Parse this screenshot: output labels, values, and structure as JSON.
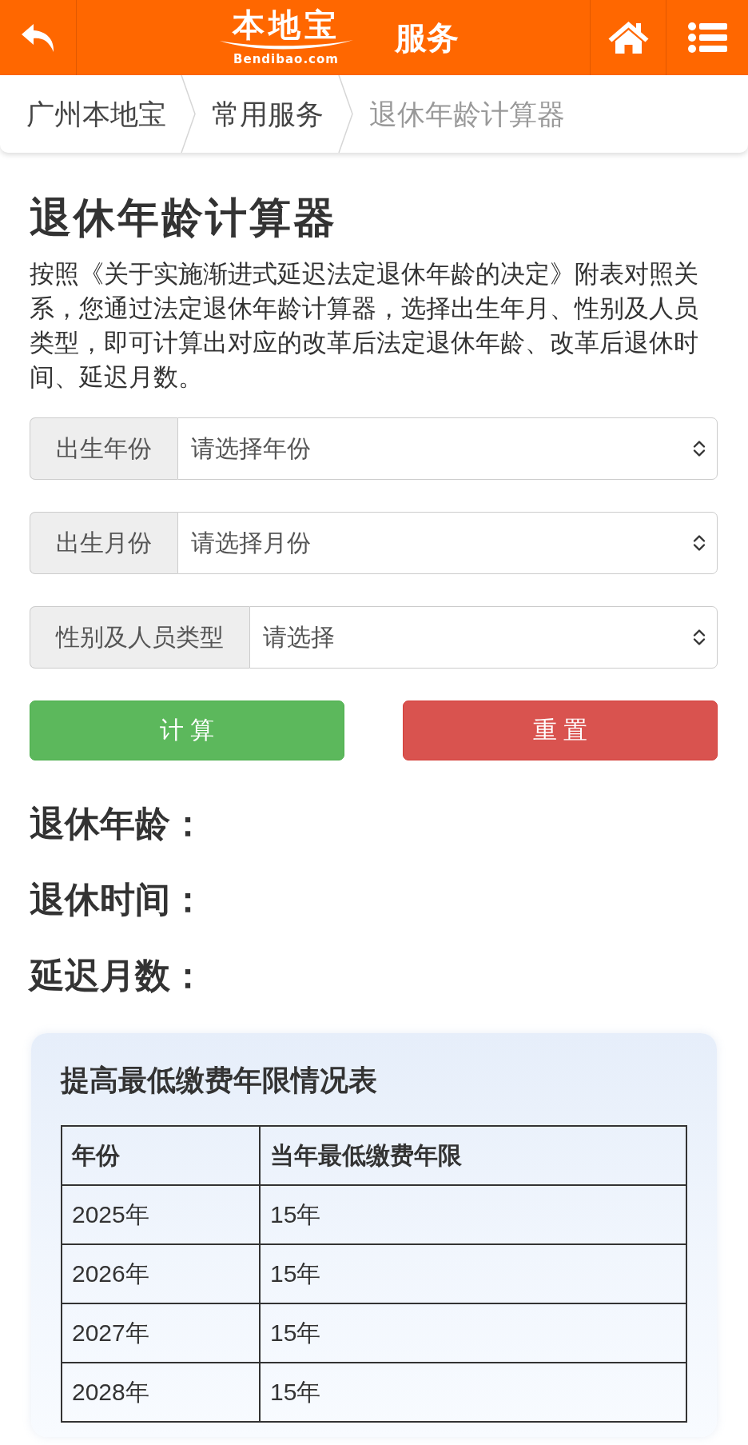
{
  "header": {
    "logo": {
      "wordmark": "本地宝",
      "domain": "Bendibao.com"
    },
    "title": "服务"
  },
  "breadcrumb": [
    {
      "label": "广州本地宝",
      "current": false
    },
    {
      "label": "常用服务",
      "current": false
    },
    {
      "label": "退休年龄计算器",
      "current": true
    }
  ],
  "page_title": "退休年龄计算器",
  "intro": "按照《关于实施渐进式延迟法定退休年龄的决定》附表对照关系，您通过法定退休年龄计算器，选择出生年月、性别及人员类型，即可计算出对应的改革后法定退休年龄、改革后退休时间、延迟月数。",
  "form": {
    "fields": [
      {
        "label": "出生年份",
        "placeholder": "请选择年份"
      },
      {
        "label": "出生月份",
        "placeholder": "请选择月份"
      },
      {
        "label": "性别及人员类型",
        "placeholder": "请选择"
      }
    ],
    "buttons": [
      {
        "label": "计 算",
        "kind": "submit"
      },
      {
        "label": "重 置",
        "kind": "reset"
      }
    ]
  },
  "results": [
    {
      "label": "退休年龄："
    },
    {
      "label": "退休时间："
    },
    {
      "label": "延迟月数："
    }
  ],
  "table_card": {
    "title": "提高最低缴费年限情况表",
    "columns": [
      "年份",
      "当年最低缴费年限"
    ],
    "rows": [
      [
        "2025年",
        "15年"
      ],
      [
        "2026年",
        "15年"
      ],
      [
        "2027年",
        "15年"
      ],
      [
        "2028年",
        "15年"
      ]
    ]
  }
}
